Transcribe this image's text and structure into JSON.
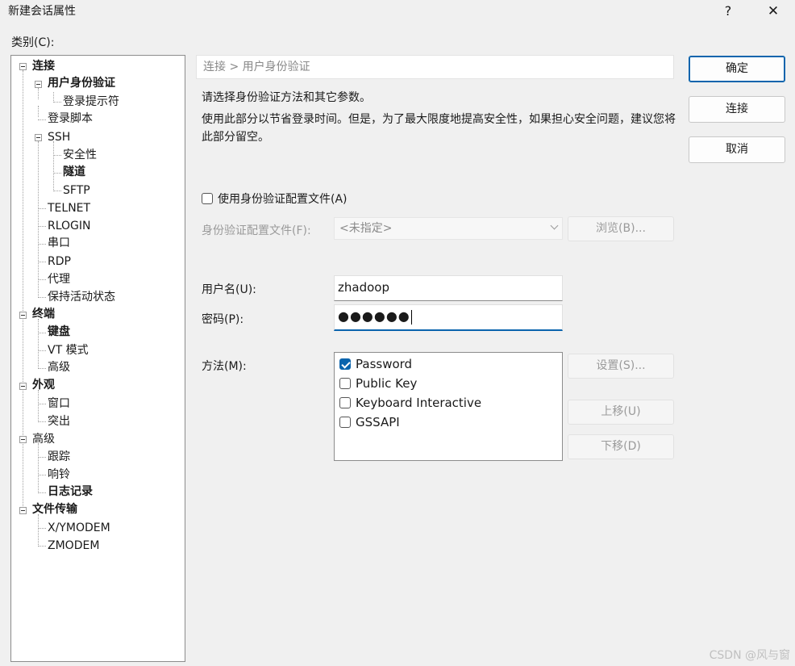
{
  "window": {
    "title": "新建会话属性",
    "help": "?",
    "close": "✕"
  },
  "category_label": "类别(C):",
  "tree": {
    "connection": "连接",
    "auth": "用户身份验证",
    "login_prompt": "登录提示符",
    "login_script": "登录脚本",
    "ssh": "SSH",
    "security": "安全性",
    "tunnel": "隧道",
    "sftp": "SFTP",
    "telnet": "TELNET",
    "rlogin": "RLOGIN",
    "serial": "串口",
    "rdp": "RDP",
    "proxy": "代理",
    "keepalive": "保持活动状态",
    "terminal": "终端",
    "keyboard": "键盘",
    "vt_mode": "VT 模式",
    "terminal_advanced": "高级",
    "appearance": "外观",
    "window": "窗口",
    "highlight": "突出",
    "advanced": "高级",
    "trace": "跟踪",
    "bell": "响铃",
    "logging": "日志记录",
    "file_transfer": "文件传输",
    "xymodem": "X/YMODEM",
    "zmodem": "ZMODEM"
  },
  "breadcrumb": "连接 > 用户身份验证",
  "description": {
    "line1": "请选择身份验证方法和其它参数。",
    "line2": "使用此部分以节省登录时间。但是，为了最大限度地提高安全性，如果担心安全问题，建议您将此部分留空。"
  },
  "use_profile": {
    "label": "使用身份验证配置文件(A)",
    "checked": false
  },
  "profile": {
    "label": "身份验证配置文件(F):",
    "value": "<未指定>",
    "browse": "浏览(B)..."
  },
  "username": {
    "label": "用户名(U):",
    "value": "zhadoop"
  },
  "password": {
    "label": "密码(P):",
    "value": "●●●●●●"
  },
  "method": {
    "label": "方法(M):",
    "items": [
      {
        "label": "Password",
        "checked": true
      },
      {
        "label": "Public Key",
        "checked": false
      },
      {
        "label": "Keyboard Interactive",
        "checked": false
      },
      {
        "label": "GSSAPI",
        "checked": false
      }
    ],
    "settings": "设置(S)...",
    "move_up": "上移(U)",
    "move_down": "下移(D)"
  },
  "buttons": {
    "ok": "确定",
    "connect": "连接",
    "cancel": "取消"
  },
  "watermark": "CSDN @风与窗",
  "colors": {
    "accent": "#0a64ad",
    "disabled_text": "#9a9a9a"
  }
}
